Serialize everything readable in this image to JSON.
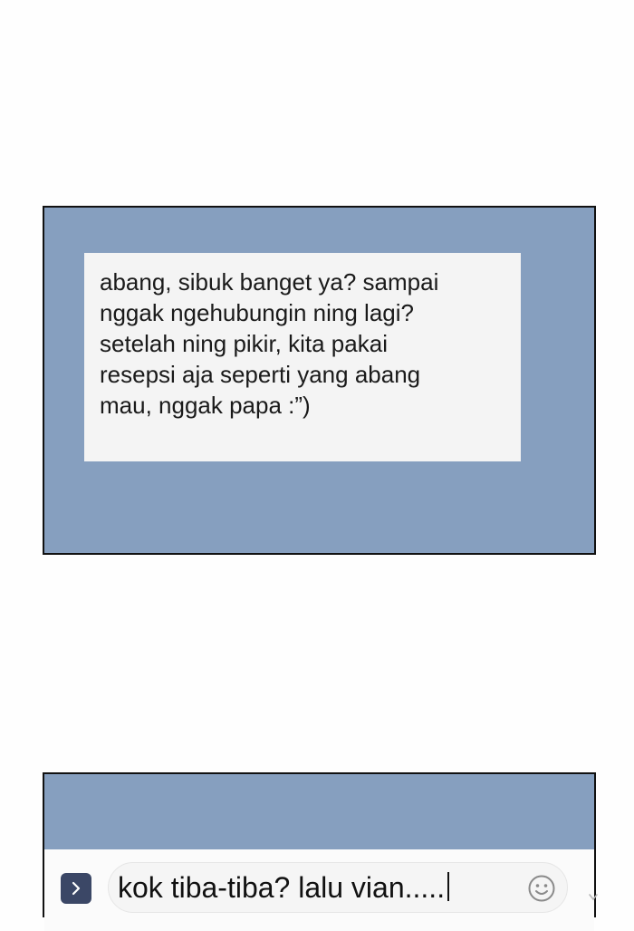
{
  "chat_preview": {
    "message_lines": [
      "abang, sibuk banget ya? sampai",
      "nggak ngehubungin ning lagi?",
      "setelah ning pikir, kita pakai",
      "resepsi aja seperti yang abang",
      "mau, nggak papa :”)"
    ]
  },
  "composer": {
    "draft_text": "kok tiba-tiba? lalu vian.....",
    "expand_icon": "chevron-right-icon",
    "emoji_icon": "smiley-icon"
  },
  "colors": {
    "panel_bg": "#869fbf",
    "bubble_bg": "#f4f4f4",
    "border": "#111111",
    "expand_button": "#3b4766"
  }
}
